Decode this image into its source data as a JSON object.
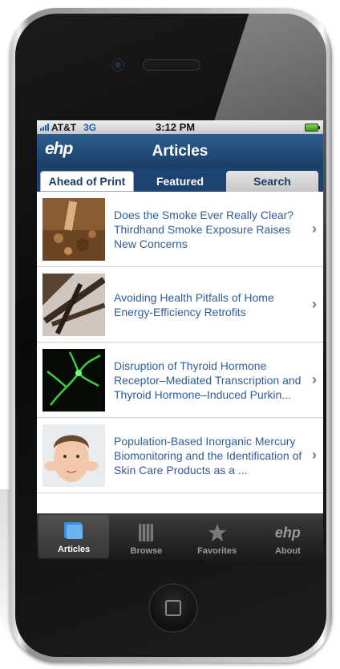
{
  "status_bar": {
    "carrier": "AT&T",
    "network": "3G",
    "time": "3:12 PM",
    "battery_icon": "battery-icon",
    "signal_icon": "signal-bars-icon"
  },
  "nav": {
    "logo": "ehp",
    "title": "Articles"
  },
  "segments": {
    "ahead": "Ahead of Print",
    "featured": "Featured",
    "search": "Search"
  },
  "articles": [
    {
      "title": "Does the Smoke Ever Really Clear? Thirdhand Smoke Exposure Raises New Concerns",
      "thumb_icon": "cigarette-ash-thumbnail"
    },
    {
      "title": "Avoiding Health Pitfalls of Home Energy-Efficiency Retrofits",
      "thumb_icon": "attic-beams-thumbnail"
    },
    {
      "title": "Disruption of Thyroid Hormone Receptor–Mediated Transcription and Thyroid Hormone–Induced Purkin...",
      "thumb_icon": "green-neuron-thumbnail"
    },
    {
      "title": "Population-Based Inorganic Mercury Biomonitoring and the Identification of Skin Care Products as a ...",
      "thumb_icon": "woman-face-cream-thumbnail"
    }
  ],
  "tabs": [
    {
      "label": "Articles",
      "icon": "articles-icon"
    },
    {
      "label": "Browse",
      "icon": "browse-icon"
    },
    {
      "label": "Favorites",
      "icon": "star-icon"
    },
    {
      "label": "About",
      "icon": "ehp-logo-icon"
    }
  ],
  "tabs_about_glyph": "ehp",
  "colors": {
    "nav_blue": "#1a3e66",
    "link_blue": "#2f5d97",
    "tabbar": "#1a1a1a"
  }
}
